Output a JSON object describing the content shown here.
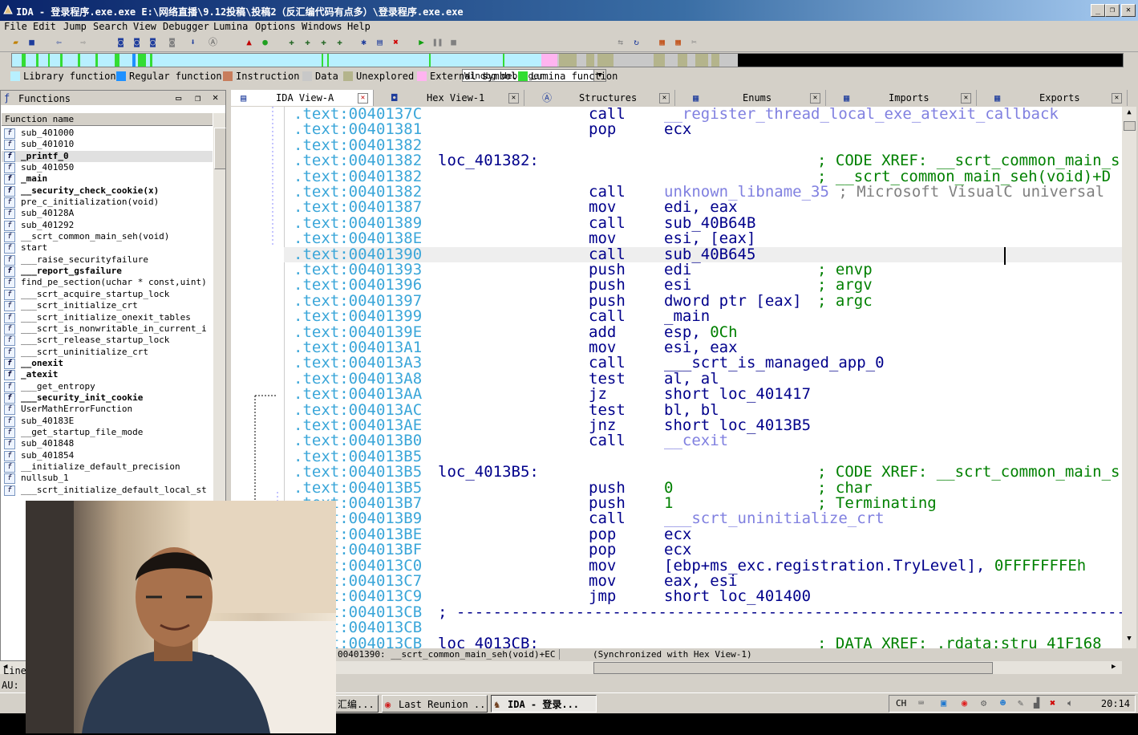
{
  "window": {
    "title": "IDA - 登录程序.exe.exe E:\\网络直播\\9.12投稿\\投稿2（反汇编代码有点多）\\登录程序.exe.exe",
    "buttons": [
      "_",
      "❐",
      "✕"
    ]
  },
  "menu": [
    "File",
    "Edit",
    "Jump",
    "Search",
    "View",
    "Debugger",
    "Lumina",
    "Options",
    "Windows",
    "Help"
  ],
  "toolbar": {
    "debugger_select": "Windbg debugger"
  },
  "legend": [
    {
      "label": "Library function",
      "color": "#b8f0ff"
    },
    {
      "label": "Regular function",
      "color": "#1e90ff"
    },
    {
      "label": "Instruction",
      "color": "#c87d5c"
    },
    {
      "label": "Data",
      "color": "#c8c8c8"
    },
    {
      "label": "Unexplored",
      "color": "#b4b48c"
    },
    {
      "label": "External symbol",
      "color": "#ffb4f0"
    },
    {
      "label": "Lumina function",
      "color": "#33dd33"
    }
  ],
  "functions_panel": {
    "title": "Functions",
    "column_header": "Function name",
    "items": [
      {
        "name": "sub_401000",
        "bold": false
      },
      {
        "name": "sub_401010",
        "bold": false
      },
      {
        "name": "_printf_0",
        "bold": true,
        "selected": true
      },
      {
        "name": "sub_401050",
        "bold": false
      },
      {
        "name": "_main",
        "bold": true
      },
      {
        "name": "__security_check_cookie(x)",
        "bold": true
      },
      {
        "name": "pre_c_initialization(void)",
        "bold": false
      },
      {
        "name": "sub_40128A",
        "bold": false
      },
      {
        "name": "sub_401292",
        "bold": false
      },
      {
        "name": "__scrt_common_main_seh(void)",
        "bold": false
      },
      {
        "name": "start",
        "bold": false
      },
      {
        "name": "___raise_securityfailure",
        "bold": false
      },
      {
        "name": "___report_gsfailure",
        "bold": true
      },
      {
        "name": "find_pe_section(uchar * const,uint)",
        "bold": false
      },
      {
        "name": "___scrt_acquire_startup_lock",
        "bold": false
      },
      {
        "name": "___scrt_initialize_crt",
        "bold": false
      },
      {
        "name": "___scrt_initialize_onexit_tables",
        "bold": false
      },
      {
        "name": "___scrt_is_nonwritable_in_current_i",
        "bold": false
      },
      {
        "name": "___scrt_release_startup_lock",
        "bold": false
      },
      {
        "name": "___scrt_uninitialize_crt",
        "bold": false
      },
      {
        "name": "__onexit",
        "bold": true
      },
      {
        "name": "_atexit",
        "bold": true
      },
      {
        "name": "___get_entropy",
        "bold": false
      },
      {
        "name": "___security_init_cookie",
        "bold": true
      },
      {
        "name": "UserMathErrorFunction",
        "bold": false
      },
      {
        "name": "sub_40183E",
        "bold": false
      },
      {
        "name": "__get_startup_file_mode",
        "bold": false
      },
      {
        "name": "sub_401848",
        "bold": false
      },
      {
        "name": "sub_401854",
        "bold": false
      },
      {
        "name": "__initialize_default_precision",
        "bold": false
      },
      {
        "name": "nullsub_1",
        "bold": false
      },
      {
        "name": "___scrt_initialize_default_local_st",
        "bold": false
      }
    ]
  },
  "tabs": [
    {
      "label": "IDA View-A",
      "active": true
    },
    {
      "label": "Hex View-1",
      "active": false
    },
    {
      "label": "Structures",
      "active": false
    },
    {
      "label": "Enums",
      "active": false
    },
    {
      "label": "Imports",
      "active": false
    },
    {
      "label": "Exports",
      "active": false
    }
  ],
  "disasm": [
    {
      "addr": ".text:0040137C",
      "mn": "call",
      "op": "__register_thread_local_exe_atexit_callback",
      "opclass": "fnc"
    },
    {
      "addr": ".text:00401381",
      "mn": "pop",
      "op": "ecx"
    },
    {
      "addr": ".text:00401382"
    },
    {
      "addr": ".text:00401382",
      "label": "loc_401382:",
      "cm": "; CODE XREF: __scrt_common_main_s"
    },
    {
      "addr": ".text:00401382",
      "cm": "; __scrt_common_main_seh(void)+D"
    },
    {
      "addr": ".text:00401382",
      "mn": "call",
      "op": "unknown_libname_35",
      "opclass": "fnc",
      "tail": " ; Microsoft VisualC universal"
    },
    {
      "addr": ".text:00401387",
      "mn": "mov",
      "op": "edi, eax"
    },
    {
      "addr": ".text:00401389",
      "mn": "call",
      "op": "sub_40B64B"
    },
    {
      "addr": ".text:0040138E",
      "mn": "mov",
      "op": "esi, [eax]"
    },
    {
      "addr": ".text:00401390",
      "mn": "call",
      "op": "sub_40B645",
      "highlight": true
    },
    {
      "addr": ".text:00401393",
      "mn": "push",
      "op": "edi",
      "cm": "; envp"
    },
    {
      "addr": ".text:00401396",
      "mn": "push",
      "op": "esi",
      "cm": "; argv"
    },
    {
      "addr": ".text:00401397",
      "mn": "push",
      "op": "dword ptr [eax]",
      "cm": "; argc"
    },
    {
      "addr": ".text:00401399",
      "mn": "call",
      "op": "_main"
    },
    {
      "addr": ".text:0040139E",
      "mn": "add",
      "op": "esp, ",
      "num": "0Ch"
    },
    {
      "addr": ".text:004013A1",
      "mn": "mov",
      "op": "esi, eax"
    },
    {
      "addr": ".text:004013A3",
      "mn": "call",
      "op": "___scrt_is_managed_app_0"
    },
    {
      "addr": ".text:004013A8",
      "mn": "test",
      "op": "al, al"
    },
    {
      "addr": ".text:004013AA",
      "mn": "jz",
      "op": "short loc_401417"
    },
    {
      "addr": ".text:004013AC",
      "mn": "test",
      "op": "bl, bl"
    },
    {
      "addr": ".text:004013AE",
      "mn": "jnz",
      "op": "short loc_4013B5"
    },
    {
      "addr": ".text:004013B0",
      "mn": "call",
      "op": "__cexit",
      "opclass": "fnc"
    },
    {
      "addr": ".text:004013B5"
    },
    {
      "addr": ".text:004013B5",
      "label": "loc_4013B5:",
      "cm": "; CODE XREF: __scrt_common_main_s"
    },
    {
      "addr": ".text:004013B5",
      "mn": "push",
      "num": "0",
      "cm": "; char"
    },
    {
      "addr": ".text:004013B7",
      "mn": "push",
      "num": "1",
      "cm": "; Terminating"
    },
    {
      "addr": ".text:004013B9",
      "mn": "call",
      "op": "___scrt_uninitialize_crt",
      "opclass": "fnc"
    },
    {
      "addr": ".text:004013BE",
      "mn": "pop",
      "op": "ecx"
    },
    {
      "addr": ".text:004013BF",
      "mn": "pop",
      "op": "ecx"
    },
    {
      "addr": ".text:004013C0",
      "mn": "mov",
      "op": "[ebp+ms_exc.registration.TryLevel], ",
      "num": "0FFFFFFFEh"
    },
    {
      "addr": ".text:004013C7",
      "mn": "mov",
      "op": "eax, esi"
    },
    {
      "addr": ".text:004013C9",
      "mn": "jmp",
      "op": "short loc_401400"
    },
    {
      "addr": ".text:004013CB",
      "sep": "; ---------------------------------------------------------------------------"
    },
    {
      "addr": ".text:004013CB"
    },
    {
      "addr": ".text:004013CB",
      "label": "loc_4013CB:",
      "cm": "; DATA XREF: .rdata:stru_41F168"
    }
  ],
  "status": {
    "location": "00401390: __scrt_common_main_seh(void)+EC",
    "sync": "(Synchronized with Hex View-1)"
  },
  "output": {
    "line_label": "Line",
    "au_label": "AU:"
  },
  "taskbar": {
    "items": [
      {
        "label": "汇编...",
        "active": false
      },
      {
        "label": "Last Reunion ...",
        "active": false
      },
      {
        "label": "IDA - 登录...",
        "active": true
      }
    ],
    "tray_lang": "CH",
    "clock": "20:14"
  }
}
